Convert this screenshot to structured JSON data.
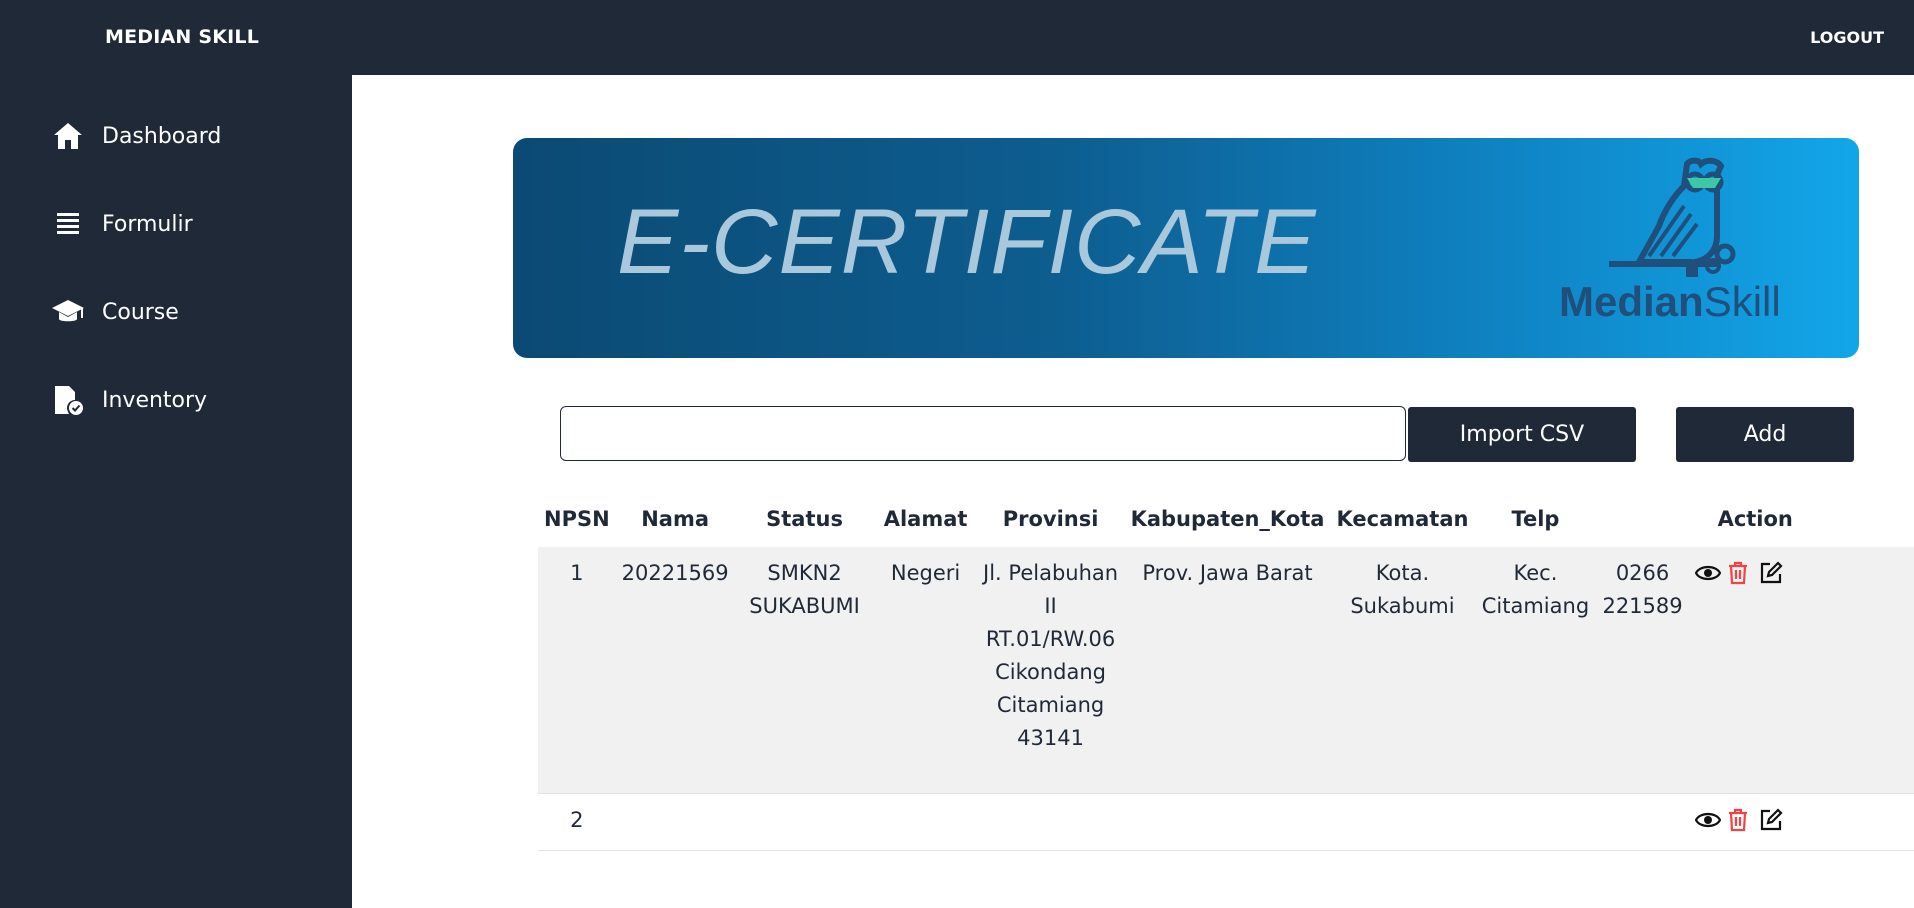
{
  "header": {
    "brand": "MEDIAN SKILL",
    "logout_label": "LOGOUT"
  },
  "sidebar": {
    "items": [
      {
        "label": "Dashboard",
        "icon": "home-icon"
      },
      {
        "label": "Formulir",
        "icon": "list-icon"
      },
      {
        "label": "Course",
        "icon": "graduation-cap-icon"
      },
      {
        "label": "Inventory",
        "icon": "file-check-icon"
      }
    ]
  },
  "banner": {
    "title": "E-CERTIFICATE",
    "logo_bold": "Median",
    "logo_light": "Skill"
  },
  "search": {
    "value": "",
    "placeholder": ""
  },
  "buttons": {
    "import_label": "Import CSV",
    "add_label": "Add"
  },
  "table": {
    "headers": [
      "NPSN",
      "Nama",
      "Status",
      "Alamat",
      "Provinsi",
      "Kabupaten_Kota",
      "Kecamatan",
      "Telp",
      "Action"
    ],
    "rows": [
      {
        "no": "1",
        "npsn": "20221569",
        "nama": "SMKN2 SUKABUMI",
        "status": "Negeri",
        "alamat": "Jl. Pelabuhan II RT.01/RW.06 Cikondang Citamiang 43141",
        "provinsi": "Prov. Jawa Barat",
        "kabupaten_kota": "Kota. Sukabumi",
        "kecamatan": "Kec. Citamiang",
        "telp": "0266 221589"
      },
      {
        "no": "2",
        "npsn": "",
        "nama": "",
        "status": "",
        "alamat": "",
        "provinsi": "",
        "kabupaten_kota": "",
        "kecamatan": "",
        "telp": ""
      }
    ]
  },
  "colors": {
    "sidebar_bg": "#1f2937",
    "delete_icon": "#ef4444",
    "banner_start": "#0b4a74",
    "banner_end": "#12a6e9"
  }
}
